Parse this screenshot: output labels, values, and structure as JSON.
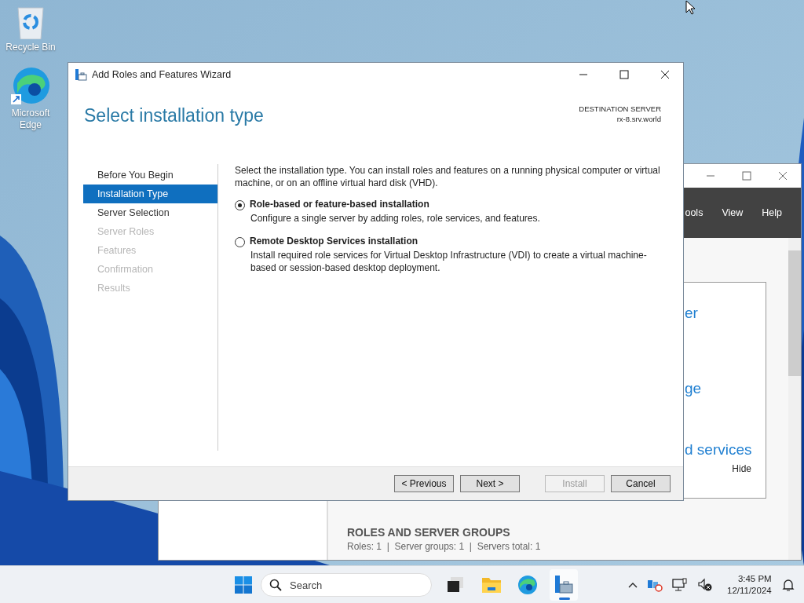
{
  "desktop_icons": [
    {
      "kind": "recycle",
      "label": "Recycle Bin"
    },
    {
      "kind": "edge",
      "label": "Microsoft Edge"
    }
  ],
  "background_window": {
    "menu": [
      "ools",
      "View",
      "Help"
    ],
    "panel_texts": [
      "er",
      "ge",
      "d services"
    ],
    "hide_link": "Hide",
    "section_title": "ROLES AND SERVER GROUPS",
    "section_summary": "Roles: 1  |  Server groups: 1  |  Servers total: 1"
  },
  "wizard": {
    "title": "Add Roles and Features Wizard",
    "heading": "Select installation type",
    "destination_label": "DESTINATION SERVER",
    "destination_server": "rx-8.srv.world",
    "steps": [
      {
        "label": "Before You Begin",
        "selected": false,
        "disabled": false
      },
      {
        "label": "Installation Type",
        "selected": true,
        "disabled": false
      },
      {
        "label": "Server Selection",
        "selected": false,
        "disabled": false
      },
      {
        "label": "Server Roles",
        "selected": false,
        "disabled": true
      },
      {
        "label": "Features",
        "selected": false,
        "disabled": true
      },
      {
        "label": "Confirmation",
        "selected": false,
        "disabled": true
      },
      {
        "label": "Results",
        "selected": false,
        "disabled": true
      }
    ],
    "intro": "Select the installation type. You can install roles and features on a running physical computer or virtual machine, or on an offline virtual hard disk (VHD).",
    "options": [
      {
        "label": "Role-based or feature-based installation",
        "description": "Configure a single server by adding roles, role services, and features.",
        "selected": true
      },
      {
        "label": "Remote Desktop Services installation",
        "description": "Install required role services for Virtual Desktop Infrastructure (VDI) to create a virtual machine-based or session-based desktop deployment.",
        "selected": false
      }
    ],
    "buttons": [
      {
        "label": "< Previous",
        "disabled": false
      },
      {
        "label": "Next >",
        "disabled": false
      },
      {
        "label": "Install",
        "disabled": true
      },
      {
        "label": "Cancel",
        "disabled": false
      }
    ]
  },
  "taskbar": {
    "search_placeholder": "Search",
    "apps": [
      {
        "kind": "taskview",
        "active": false
      },
      {
        "kind": "folder",
        "active": false
      },
      {
        "kind": "edge",
        "active": false
      },
      {
        "kind": "servermanager",
        "active": true
      }
    ],
    "time": "3:45 PM",
    "date": "12/11/2024"
  }
}
